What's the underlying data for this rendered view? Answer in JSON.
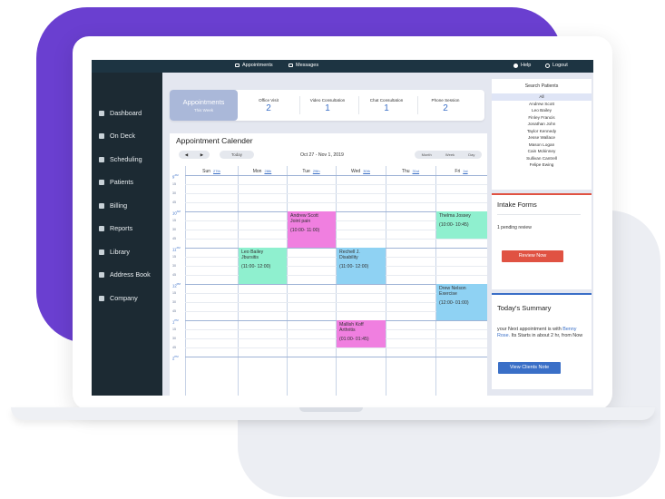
{
  "topbar": {
    "appointments": "Appointments",
    "messages": "Messages",
    "help": "Help",
    "logout": "Logout"
  },
  "sidebar": {
    "items": [
      {
        "label": "Dashboard",
        "icon": "dashboard-icon"
      },
      {
        "label": "On Deck",
        "icon": "on-deck-icon"
      },
      {
        "label": "Scheduling",
        "icon": "calendar-icon"
      },
      {
        "label": "Patients",
        "icon": "patients-icon"
      },
      {
        "label": "Billing",
        "icon": "dollar-icon"
      },
      {
        "label": "Reports",
        "icon": "reports-icon"
      },
      {
        "label": "Library",
        "icon": "library-icon"
      },
      {
        "label": "Address Book",
        "icon": "address-book-icon"
      },
      {
        "label": "Company",
        "icon": "company-icon"
      }
    ]
  },
  "stats": {
    "main_title": "Appointments",
    "main_sub": "This Week",
    "items": [
      {
        "label": "Office Visit",
        "value": "2"
      },
      {
        "label": "Video Consultation",
        "value": "1"
      },
      {
        "label": "Chat Consultation",
        "value": "1"
      },
      {
        "label": "Phone Session",
        "value": "2"
      }
    ]
  },
  "calendar": {
    "title": "Appointment Calender",
    "today": "Today",
    "range": "Oct 27 - Nov 1, 2019",
    "views": [
      "Month",
      "Week",
      "Day"
    ],
    "days": [
      {
        "name": "Sun",
        "num": "27th"
      },
      {
        "name": "Mon",
        "num": "28th"
      },
      {
        "name": "Tue",
        "num": "29th"
      },
      {
        "name": "Wed",
        "num": "30th"
      },
      {
        "name": "Thu",
        "num": "31st"
      },
      {
        "name": "Fri",
        "num": "1st"
      }
    ],
    "hours": [
      {
        "h": "9",
        "suf": "AM"
      },
      {
        "h": "10",
        "suf": "AM"
      },
      {
        "h": "11",
        "suf": "AM"
      },
      {
        "h": "12",
        "suf": "PM"
      },
      {
        "h": "1",
        "suf": "PM"
      },
      {
        "h": "2",
        "suf": "PM"
      }
    ],
    "minutes": [
      "15",
      "30",
      "45"
    ],
    "appointments": [
      {
        "name": "Andrew Scott",
        "reason": "Joint pain",
        "time": "(10:00- 11:00)",
        "day": 2,
        "start": 10.0,
        "end": 11.0,
        "color": "pink"
      },
      {
        "name": "Thelma Jossey",
        "reason": "",
        "time": "(10:00- 10:45)",
        "day": 5,
        "start": 10.0,
        "end": 10.75,
        "color": "green"
      },
      {
        "name": "Leo Bailey",
        "reason": "Jbursitis",
        "time": "(11:00- 12:00)",
        "day": 1,
        "start": 11.0,
        "end": 12.0,
        "color": "green"
      },
      {
        "name": "Rechell J.",
        "reason": "Disability",
        "time": "(11:00- 12:00)",
        "day": 3,
        "start": 11.0,
        "end": 12.0,
        "color": "blue"
      },
      {
        "name": "Drew Nelson",
        "reason": "Exercise",
        "time": "(12:00- 01:00)",
        "day": 5,
        "start": 12.0,
        "end": 13.0,
        "color": "blue"
      },
      {
        "name": "Mallish Koff",
        "reason": "Arthritis",
        "time": "(01:00- 01:45)",
        "day": 3,
        "start": 13.0,
        "end": 13.75,
        "color": "pink"
      }
    ]
  },
  "search": {
    "title": "Search Patients",
    "patients": [
      "All",
      "Andrew Scott",
      "Leo Bailey",
      "Finley Francis",
      "Jonathan John",
      "Taylor Kennedy",
      "Jesse Wallace",
      "Mason Logan",
      "Cain Mckinney",
      "Sullivan Cantrell",
      "Felipe Ewing"
    ]
  },
  "intake": {
    "title": "Intake Forms",
    "text": "1 pending review",
    "button": "Review Now"
  },
  "summary": {
    "title": "Today's Summary",
    "pre": "your Next appointment is with ",
    "name": "Benny Rose.",
    "post": " Its Starts in about 2 hr, from Now",
    "button": "View Clients Note"
  },
  "colors": {
    "accent": "#3a6fc7",
    "danger": "#e05242",
    "sidebar": "#1c2a33",
    "topbar": "#1d3442",
    "purple": "#6a3fd0"
  }
}
